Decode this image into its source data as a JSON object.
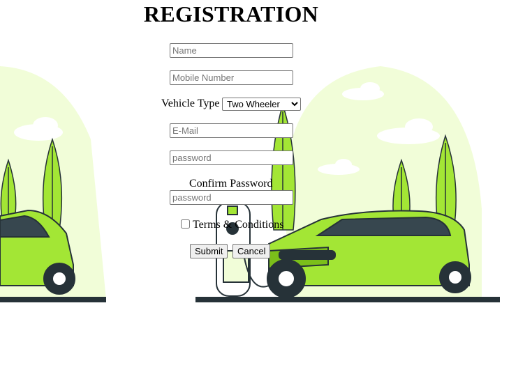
{
  "form": {
    "title": "REGISTRATION",
    "name_placeholder": "Name",
    "mobile_placeholder": "Mobile Number",
    "vehicle_type_label": "Vehicle Type",
    "vehicle_type_selected": "Two Wheeler",
    "email_placeholder": "E-Mail",
    "password_placeholder": "password",
    "confirm_password_label": "Confirm Password",
    "confirm_password_placeholder": "password",
    "terms_label": "Terms & Conditions",
    "submit_label": "Submit",
    "cancel_label": "Cancel"
  },
  "colors": {
    "lime": "#a3e635",
    "pale_green": "#f0fdd4",
    "dark": "#263238"
  }
}
